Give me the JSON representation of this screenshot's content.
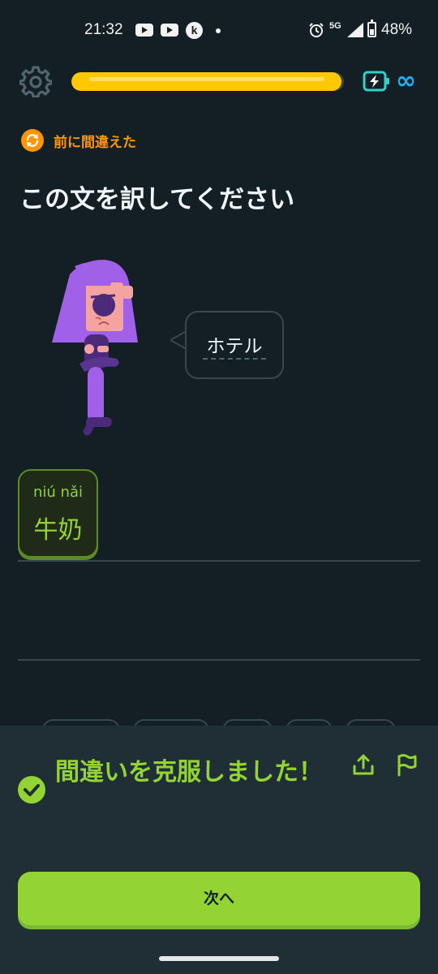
{
  "status_bar": {
    "time": "21:32",
    "network": "5G",
    "battery_percent": "48%",
    "icons": [
      "youtube-icon",
      "youtube-icon",
      "k-app-icon",
      "notification-dot",
      "alarm-icon",
      "signal-icon",
      "battery-icon"
    ]
  },
  "header": {
    "settings_icon": "gear-icon",
    "progress": 0.99,
    "energy_icon": "battery-bolt-icon",
    "unlimited": "∞"
  },
  "tag": {
    "icon": "refresh-icon",
    "label": "前に間違えた"
  },
  "prompt": "この文を訳してください",
  "bubble": {
    "text": "ホテル"
  },
  "answer": {
    "pinyin": "niú nǎi",
    "hanzi": "牛奶"
  },
  "feedback": {
    "title": "間違いを克服しました！",
    "share_icon": "share-icon",
    "report_icon": "flag-icon",
    "next_label": "次へ"
  },
  "colors": {
    "background": "#131f24",
    "accent_green": "#93d333",
    "progress_yellow": "#ffc800",
    "tag_orange": "#ff9600",
    "character_purple": "#a160e8",
    "infinity_blue": "#1cb0f6"
  }
}
